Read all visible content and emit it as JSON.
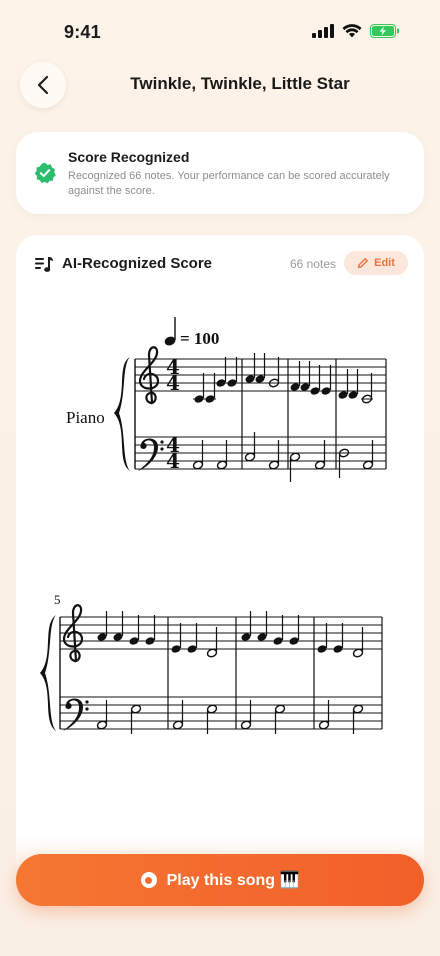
{
  "status_bar": {
    "time": "9:41"
  },
  "header": {
    "title": "Twinkle, Twinkle, Little Star"
  },
  "banner": {
    "title": "Score Recognized",
    "description": "Recognized 66 notes. Your performance can be scored accurately against the score."
  },
  "score_card": {
    "title": "AI-Recognized Score",
    "notes_count": "66 notes",
    "edit_label": "Edit",
    "tempo": "= 100",
    "instrument": "Piano",
    "time_signature": [
      "4",
      "4"
    ],
    "system2_measure_number": "5"
  },
  "play_button": {
    "label": "Play this song 🎹"
  },
  "colors": {
    "accent": "#f36a2e",
    "success": "#2dbd6e",
    "background": "#fcf1e6"
  },
  "icons": [
    "back-chevron-icon",
    "signal-icon",
    "wifi-icon",
    "battery-icon",
    "check-badge-icon",
    "music-list-icon",
    "pencil-icon",
    "record-icon"
  ]
}
